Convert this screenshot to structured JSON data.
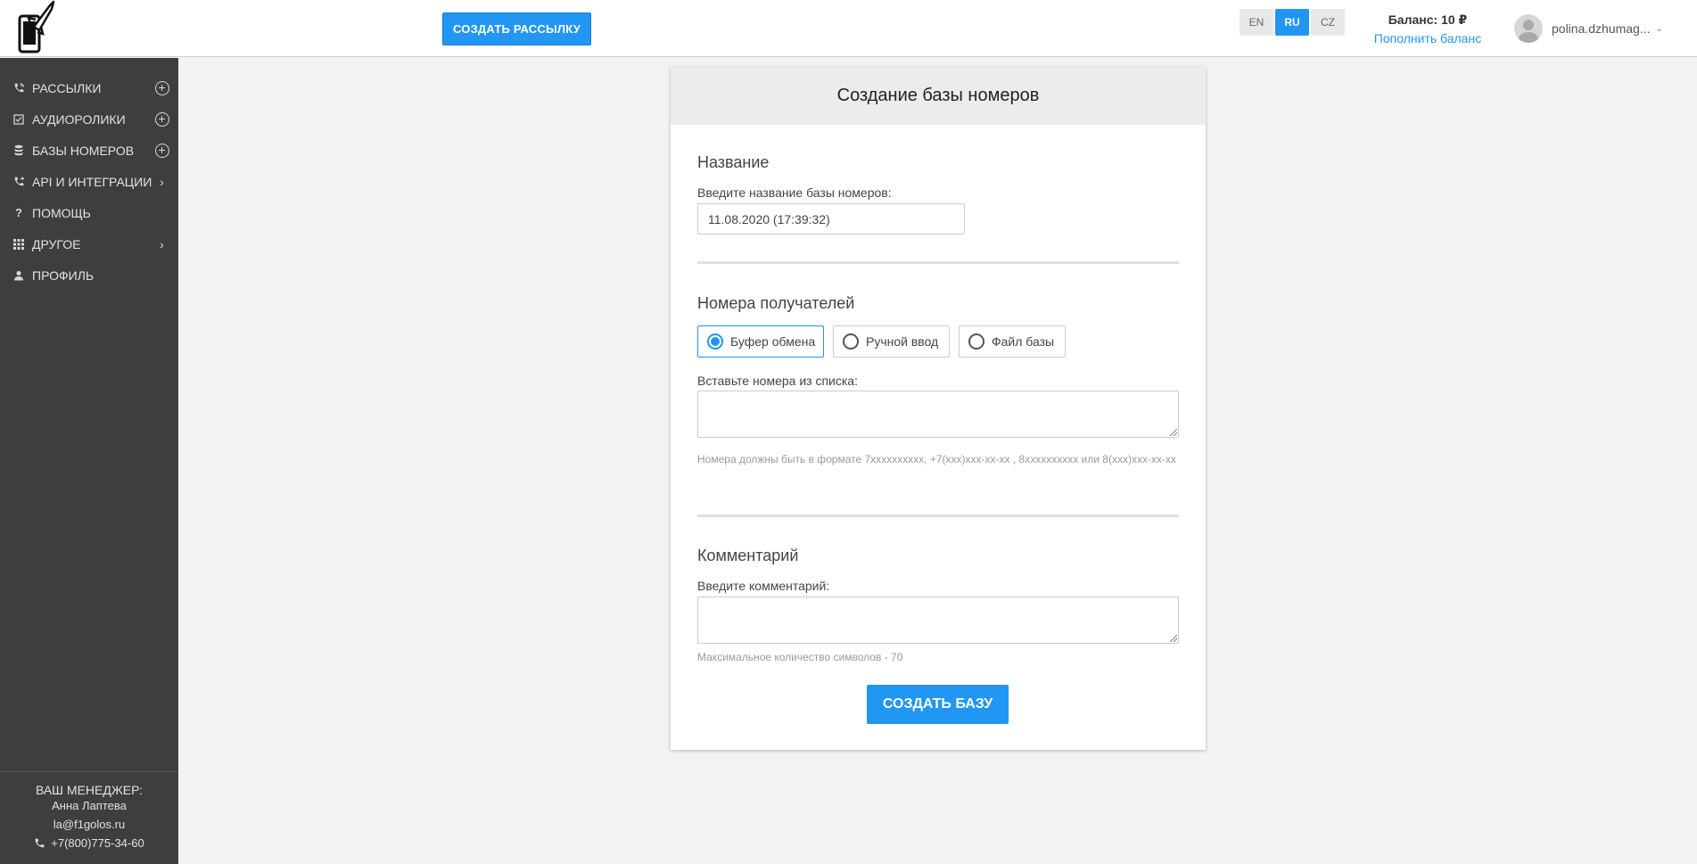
{
  "header": {
    "create_button": "СОЗДАТЬ РАССЫЛКУ",
    "languages": [
      "EN",
      "RU",
      "CZ"
    ],
    "active_language": "RU",
    "balance_title": "Баланс: 10 ₽",
    "balance_link": "Пополнить баланс",
    "username": "polina.dzhumag..."
  },
  "sidebar": {
    "items": [
      {
        "label": "РАССЫЛКИ",
        "icon": "phone-call-icon",
        "action": "plus"
      },
      {
        "label": "АУДИОРОЛИКИ",
        "icon": "checkbox-icon",
        "action": "plus"
      },
      {
        "label": "БАЗЫ НОМЕРОВ",
        "icon": "database-icon",
        "action": "plus"
      },
      {
        "label": "API И ИНТЕГРАЦИИ",
        "icon": "phone-forward-icon",
        "action": "arrow"
      },
      {
        "label": "ПОМОЩЬ",
        "icon": "question-icon",
        "action": "none"
      },
      {
        "label": "ДРУГОЕ",
        "icon": "grid-icon",
        "action": "arrow"
      },
      {
        "label": "ПРОФИЛЬ",
        "icon": "person-icon",
        "action": "none"
      }
    ],
    "manager": {
      "title": "ВАШ МЕНЕДЖЕР:",
      "name": "Анна Лаптева",
      "email": "la@f1golos.ru",
      "phone": "+7(800)775-34-60"
    }
  },
  "form": {
    "title": "Создание базы номеров",
    "name_section": "Название",
    "name_label": "Введите название базы номеров:",
    "name_value": "11.08.2020 (17:39:32)",
    "recipients_section": "Номера получателей",
    "source_options": [
      "Буфер обмена",
      "Ручной ввод",
      "Файл базы"
    ],
    "selected_source": "Буфер обмена",
    "paste_label": "Вставьте номера из списка:",
    "format_hint": "Номера должны быть в формате 7xxxxxxxxxx, +7(xxx)xxx-xx-xx , 8xxxxxxxxxx или 8(xxx)xxx-xx-xx",
    "comment_section": "Комментарий",
    "comment_label": "Введите комментарий:",
    "comment_hint": "Максимальное количество символов - 70",
    "submit": "СОЗДАТЬ БАЗУ"
  },
  "colors": {
    "accent": "#2196f3",
    "sidebar_bg": "#3e3e3e",
    "page_bg": "#f3f3f3"
  }
}
